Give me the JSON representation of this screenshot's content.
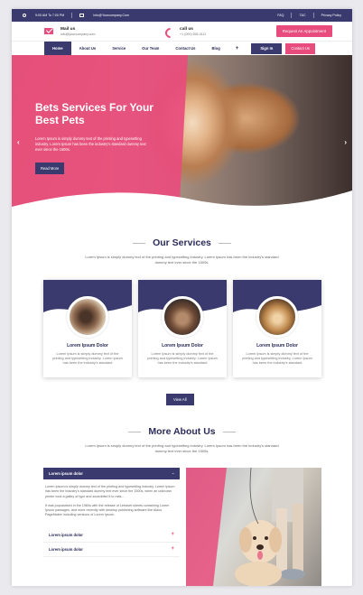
{
  "topbar": {
    "hours": "9:00 AM To 7:00 PM",
    "email": "Info@Yourcompany.Com",
    "links": [
      "FAQ",
      "T&C",
      "Privacy Policy"
    ]
  },
  "header": {
    "mail_label": "Mail us",
    "mail_value": "info@yourcompany.com",
    "call_label": "call us",
    "call_value": "+1 (000) 555-0111",
    "appointment_button": "Request An Appointment"
  },
  "nav": {
    "items": [
      "Home",
      "About Us",
      "Service",
      "Our Team",
      "Contact Us",
      "Blog"
    ],
    "plus": "+",
    "signin": "Sign In",
    "contact": "Contact Us"
  },
  "hero": {
    "title": "Bets Services For Your Best Pets",
    "text": "Lorem Ipsum is simply dummy text of the printing and typesetting industry. Lorem Ipsum has been the industry's standard dummy text ever since the 1500s.",
    "button": "Read More",
    "prev": "‹",
    "next": "›"
  },
  "services": {
    "title": "Our Services",
    "description": "Lorem Ipsum is simply dummy text of the printing and typesetting industry. Lorem Ipsum has been the industry's standard dummy text ever since the 1500s.",
    "cards": [
      {
        "title": "Lorem Ipsum Dolor",
        "text": "Lorem Ipsum is simply dummy text of the printing and typesetting industry. Lorem Ipsum has been the industry's standard"
      },
      {
        "title": "Lorem Ipsum Dolor",
        "text": "Lorem Ipsum is simply dummy text of the printing and typesetting industry. Lorem Ipsum has been the industry's standard"
      },
      {
        "title": "Lorem Ipsum Dolor",
        "text": "Lorem Ipsum is simply dummy text of the printing and typesetting industry. Lorem Ipsum has been the industry's standard"
      }
    ],
    "view_all": "View All"
  },
  "about": {
    "title": "More About Us",
    "description": "Lorem Ipsum is simply dummy text of the printing and typesetting industry. Lorem Ipsum has been the industry's standard dummy text ever since the 1500s.",
    "accordion": {
      "open_title": "Lorem ipsum dolor",
      "open_icon": "−",
      "paragraph1": "Lorem Ipsum is simply dummy text of the printing and typesetting industry. Lorem Ipsum has been the industry's standard dummy text ever since the 1500s, when an unknown printer took a galley of type and scrambled it to mak...",
      "paragraph2": "It was popularised in the 1960s with the release of Letraset sheets containing Lorem Ipsum passages, and more recently with desktop publishing software like Aldus PageMaker including versions of Lorem Ipsum.",
      "items": [
        {
          "title": "Lorem ipsum dolor",
          "icon": "+"
        },
        {
          "title": "Lorem ipsum dolor",
          "icon": "+"
        }
      ]
    }
  },
  "colors": {
    "primary": "#3a3a6e",
    "accent": "#e84c7d"
  }
}
